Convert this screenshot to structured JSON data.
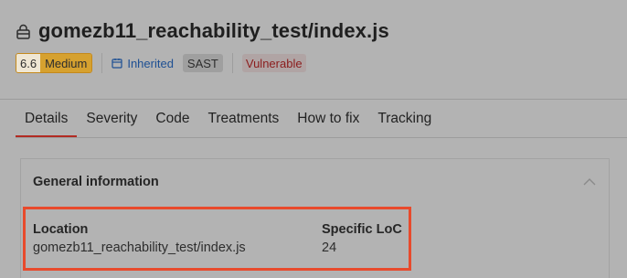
{
  "header": {
    "title": "gomezb11_reachability_test/index.js",
    "title_icon": "lock-icon"
  },
  "badges": {
    "severity_score": "6.6",
    "severity_level": "Medium",
    "inherited_label": "Inherited",
    "sast_label": "SAST",
    "vulnerable_label": "Vulnerable"
  },
  "tabs": [
    {
      "label": "Details",
      "active": true
    },
    {
      "label": "Severity",
      "active": false
    },
    {
      "label": "Code",
      "active": false
    },
    {
      "label": "Treatments",
      "active": false
    },
    {
      "label": "How to fix",
      "active": false
    },
    {
      "label": "Tracking",
      "active": false
    }
  ],
  "general_info": {
    "title": "General information",
    "location_label": "Location",
    "location_value": "gomezb11_reachability_test/index.js",
    "specific_loc_label": "Specific LoC",
    "specific_loc_value": "24"
  },
  "colors": {
    "accent": "#b22b22",
    "highlight_border": "#e84a2c",
    "medium": "#d6a12f",
    "inherited": "#1d4f93",
    "vulnerable": "#8b1c1c"
  }
}
